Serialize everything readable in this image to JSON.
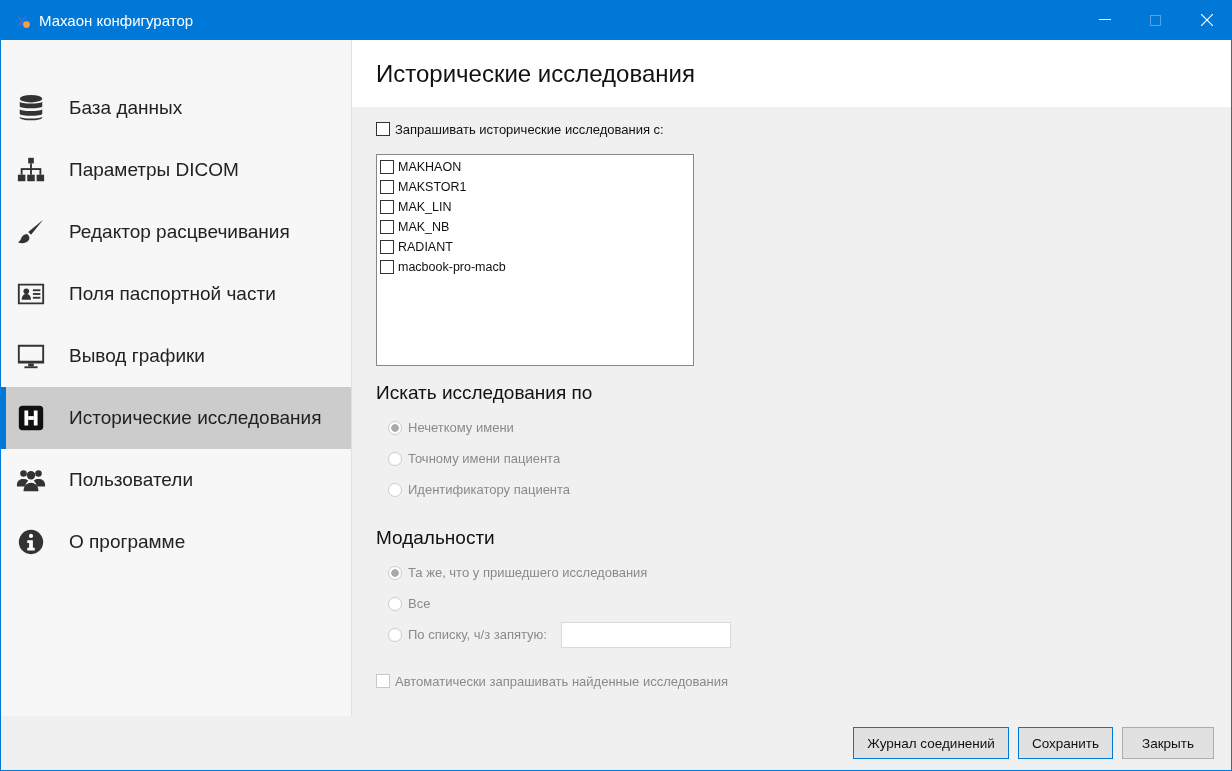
{
  "window": {
    "title": "Махаон конфигуратор"
  },
  "sidebar": {
    "items": [
      {
        "label": "База данных",
        "selected": false
      },
      {
        "label": "Параметры DICOM",
        "selected": false
      },
      {
        "label": "Редактор расцвечивания",
        "selected": false
      },
      {
        "label": "Поля паспортной части",
        "selected": false
      },
      {
        "label": "Вывод графики",
        "selected": false
      },
      {
        "label": "Исторические исследования",
        "selected": true
      },
      {
        "label": "Пользователи",
        "selected": false
      },
      {
        "label": "О программе",
        "selected": false
      }
    ]
  },
  "page": {
    "title": "Исторические исследования",
    "query_checkbox": {
      "label": "Запрашивать исторические исследования с:",
      "checked": false,
      "disabled": false
    },
    "servers": [
      {
        "label": "MAKHAON",
        "checked": false
      },
      {
        "label": "MAKSTOR1",
        "checked": false
      },
      {
        "label": "MAK_LIN",
        "checked": false
      },
      {
        "label": "MAK_NB",
        "checked": false
      },
      {
        "label": "RADIANT",
        "checked": false
      },
      {
        "label": "macbook-pro-macb",
        "checked": false
      }
    ],
    "search_by": {
      "heading": "Искать исследования по",
      "disabled": true,
      "options": [
        {
          "label": "Нечеткому имени",
          "selected": true
        },
        {
          "label": "Точному имени пациента",
          "selected": false
        },
        {
          "label": "Идентификатору пациента",
          "selected": false
        }
      ]
    },
    "modalities": {
      "heading": "Модальности",
      "disabled": true,
      "options": [
        {
          "label": "Та же, что у пришедшего исследования",
          "selected": true,
          "kind": "plain"
        },
        {
          "label": "Все",
          "selected": false,
          "kind": "plain"
        },
        {
          "label": "По списку, ч/з запятую:",
          "selected": false,
          "kind": "input"
        }
      ]
    },
    "auto_checkbox": {
      "label": "Автоматически запрашивать найденные исследования",
      "checked": false,
      "disabled": true
    }
  },
  "buttons": [
    {
      "label": "Журнал соединений",
      "highlighted": true
    },
    {
      "label": "Сохранить",
      "highlighted": true
    },
    {
      "label": "Закрыть",
      "highlighted": false
    }
  ]
}
